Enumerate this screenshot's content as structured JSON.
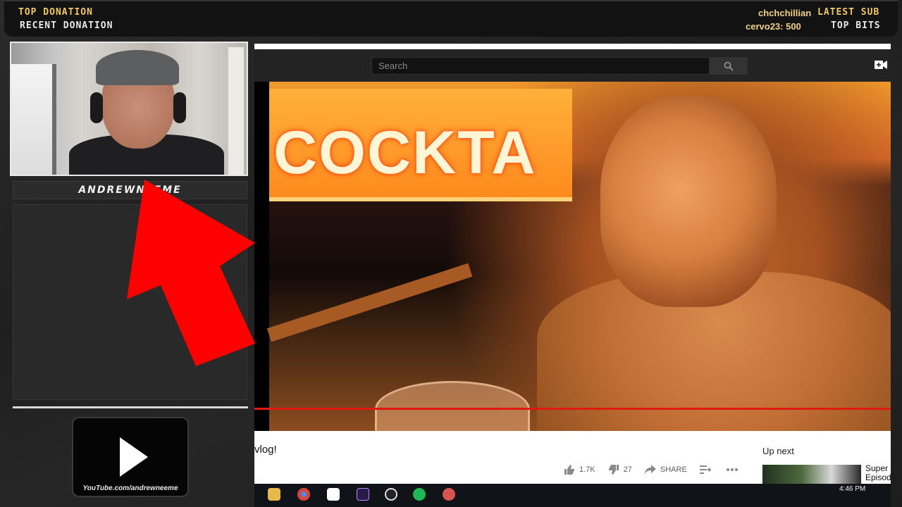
{
  "overlay": {
    "top_donation_label": "TOP DONATION",
    "recent_donation_label": "RECENT DONATION",
    "latest_sub_label": "LATEST SUB",
    "latest_sub_value": "chchchillian",
    "top_bits_label": "TOP BITS",
    "top_bits_value": "cervo23: 500",
    "streamer_name": "ANDREWNEEME",
    "youtube_url": "YouTube.com/andrewneeme",
    "colors": {
      "gold": "#f1c862",
      "arrow": "#ff0000"
    }
  },
  "youtube": {
    "search_placeholder": "Search",
    "video_title_fragment": "vlog!",
    "sign_text": "COCKTA",
    "likes": "1.7K",
    "dislikes": "27",
    "share_label": "SHARE",
    "up_next_label": "Up next",
    "rec_title_line1": "Super",
    "rec_title_line2": "Episod",
    "colors": {
      "progress": "#e01a10"
    }
  },
  "taskbar": {
    "clock": "4:46 PM",
    "icons": [
      "folder-icon",
      "chrome-icon",
      "notepad-icon",
      "premiere-icon",
      "obs-icon",
      "spotify-icon",
      "app-icon"
    ]
  }
}
